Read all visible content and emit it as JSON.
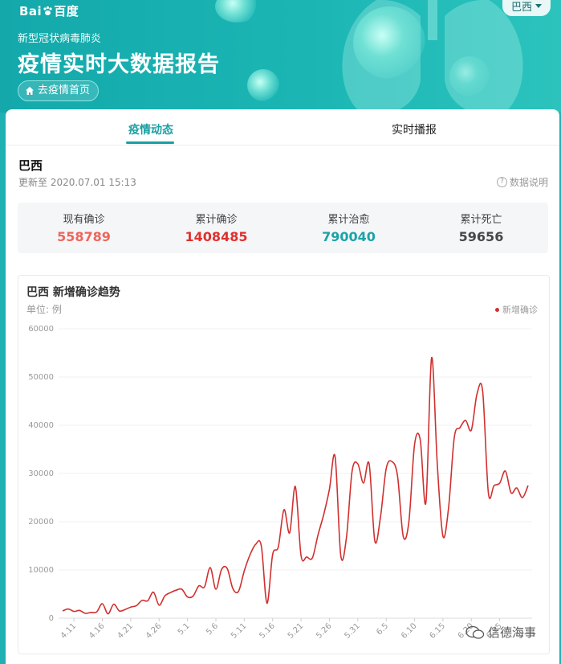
{
  "header": {
    "logo_text_left": "Bai",
    "logo_text_right": "百度",
    "subtitle": "新型冠状病毒肺炎",
    "title": "疫情实时大数据报告",
    "home_button": "去疫情首页",
    "region_selector": "巴西"
  },
  "tabs": [
    {
      "label": "疫情动态",
      "active": true
    },
    {
      "label": "实时播报",
      "active": false
    }
  ],
  "summary": {
    "country": "巴西",
    "updated": "更新至 2020.07.01 15:13",
    "data_note": "数据说明",
    "stats": [
      {
        "label": "现有确诊",
        "value": "558789",
        "color": "#f0645a"
      },
      {
        "label": "累计确诊",
        "value": "1408485",
        "color": "#e0302d"
      },
      {
        "label": "累计治愈",
        "value": "790040",
        "color": "#1aa3a8"
      },
      {
        "label": "累计死亡",
        "value": "59656",
        "color": "#474747"
      }
    ]
  },
  "chart_data": {
    "type": "line",
    "title": "巴西 新增确诊趋势",
    "unit": "单位: 例",
    "legend": "新增确诊",
    "legend_position": "top-right",
    "color": "#d0302f",
    "ylim": [
      0,
      60000
    ],
    "yticks": [
      0,
      10000,
      20000,
      30000,
      40000,
      50000,
      60000
    ],
    "grid": true,
    "xticks": [
      "4.11",
      "4.16",
      "4.21",
      "4.26",
      "5.1",
      "5.6",
      "5.11",
      "5.16",
      "5.21",
      "5.26",
      "5.31",
      "6.5",
      "6.10",
      "6.15",
      "6.20",
      "6.25"
    ],
    "x": [
      "4.9",
      "4.10",
      "4.11",
      "4.12",
      "4.13",
      "4.14",
      "4.15",
      "4.16",
      "4.17",
      "4.18",
      "4.19",
      "4.20",
      "4.21",
      "4.22",
      "4.23",
      "4.24",
      "4.25",
      "4.26",
      "4.27",
      "4.28",
      "4.29",
      "4.30",
      "5.1",
      "5.2",
      "5.3",
      "5.4",
      "5.5",
      "5.6",
      "5.7",
      "5.8",
      "5.9",
      "5.10",
      "5.11",
      "5.12",
      "5.13",
      "5.14",
      "5.15",
      "5.16",
      "5.17",
      "5.18",
      "5.19",
      "5.20",
      "5.21",
      "5.22",
      "5.23",
      "5.24",
      "5.25",
      "5.26",
      "5.27",
      "5.28",
      "5.29",
      "5.30",
      "5.31",
      "6.1",
      "6.2",
      "6.3",
      "6.4",
      "6.5",
      "6.6",
      "6.7",
      "6.8",
      "6.9",
      "6.10",
      "6.11",
      "6.12",
      "6.13",
      "6.14",
      "6.15",
      "6.16",
      "6.17",
      "6.18",
      "6.19",
      "6.20",
      "6.21",
      "6.22",
      "6.23",
      "6.24",
      "6.25",
      "6.26",
      "6.27",
      "6.28",
      "6.29",
      "6.30"
    ],
    "series": [
      {
        "name": "新增确诊",
        "values": [
          1500,
          1900,
          1400,
          1600,
          1000,
          1200,
          1300,
          3000,
          900,
          2900,
          1500,
          1800,
          2300,
          2600,
          3700,
          3600,
          5400,
          2700,
          4600,
          5300,
          5800,
          6000,
          4400,
          4600,
          6700,
          6500,
          10500,
          6000,
          10100,
          10300,
          6100,
          5600,
          9800,
          13100,
          15300,
          15000,
          3100,
          13200,
          14800,
          22500,
          17700,
          27300,
          13000,
          12700,
          12500,
          17300,
          21500,
          26700,
          33500,
          13000,
          16700,
          30500,
          32000,
          28000,
          32000,
          16000,
          21000,
          31000,
          32500,
          29500,
          17000,
          20000,
          36000,
          37000,
          24000,
          54000,
          32000,
          17000,
          23000,
          37500,
          39500,
          41000,
          39000,
          46500,
          47000,
          26000,
          27500,
          28000,
          30500,
          26000,
          27000,
          25000,
          27500
        ]
      }
    ]
  },
  "watermark": "信德海事"
}
